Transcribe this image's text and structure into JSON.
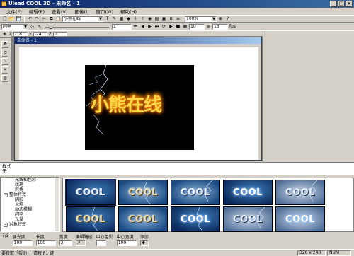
{
  "window": {
    "title": "Ulead COOL 3D - 未命名 - 1"
  },
  "menu": [
    "文件(F)",
    "编辑(E)",
    "查看(V)",
    "图像(I)",
    "窗口(W)",
    "帮助(H)"
  ],
  "toolbar1": {
    "text_combo": "小熊在线",
    "zoom_combo": "100%"
  },
  "toolbar2": {
    "effect_combo": "闪电",
    "frame_value": "1",
    "frame_total": "10",
    "fps_value": "15",
    "fps_label": "fps"
  },
  "toolbar3": {
    "x_label": "X",
    "x_value": "-18",
    "y_label": "Y",
    "y_value": "-24",
    "z_label": "Z",
    "z_value": "0"
  },
  "document": {
    "title": "未命名 - 1",
    "render_text": "小熊在线"
  },
  "style_panel": {
    "label": "样式",
    "value": "无"
  },
  "tree": {
    "items": [
      {
        "label": "光线和色彩",
        "level": 2
      },
      {
        "label": "纹理",
        "level": 2
      },
      {
        "label": "斜角",
        "level": 2
      },
      {
        "label": "整体特效",
        "level": 1,
        "expander": "−"
      },
      {
        "label": "阴影",
        "level": 2
      },
      {
        "label": "火焰",
        "level": 2
      },
      {
        "label": "动态模糊",
        "level": 2
      },
      {
        "label": "闪电",
        "level": 2
      },
      {
        "label": "光晕",
        "level": 2
      },
      {
        "label": "对象特效",
        "level": 1,
        "expander": "+"
      }
    ]
  },
  "thumbnails": [
    {
      "text": "COOL",
      "variant": ""
    },
    {
      "text": "COOL",
      "variant": "gold light"
    },
    {
      "text": "COOL",
      "variant": "light"
    },
    {
      "text": "COOL",
      "variant": "blue"
    },
    {
      "text": "COOL",
      "variant": "white"
    },
    {
      "text": "COOL",
      "variant": "gold"
    },
    {
      "text": "COOL",
      "variant": "gold light"
    },
    {
      "text": "COOL",
      "variant": "blue"
    },
    {
      "text": "COOL",
      "variant": "white"
    },
    {
      "text": "COOL",
      "variant": "white blue"
    }
  ],
  "properties": {
    "frame": "7/2",
    "brightness_label": "强光度",
    "brightness_value": "100",
    "length_label": "长度",
    "length_value": "100",
    "width_label": "宽度",
    "width_value": "2",
    "path_label": "编辑路径",
    "center_color_label": "中心色彩",
    "center_width_label": "中心宽度",
    "center_width_value": "100",
    "add_label": "添加"
  },
  "status": {
    "help": "要获取「帮助」，请按 F1 键",
    "size": "320 x 240",
    "num": "NUM"
  }
}
